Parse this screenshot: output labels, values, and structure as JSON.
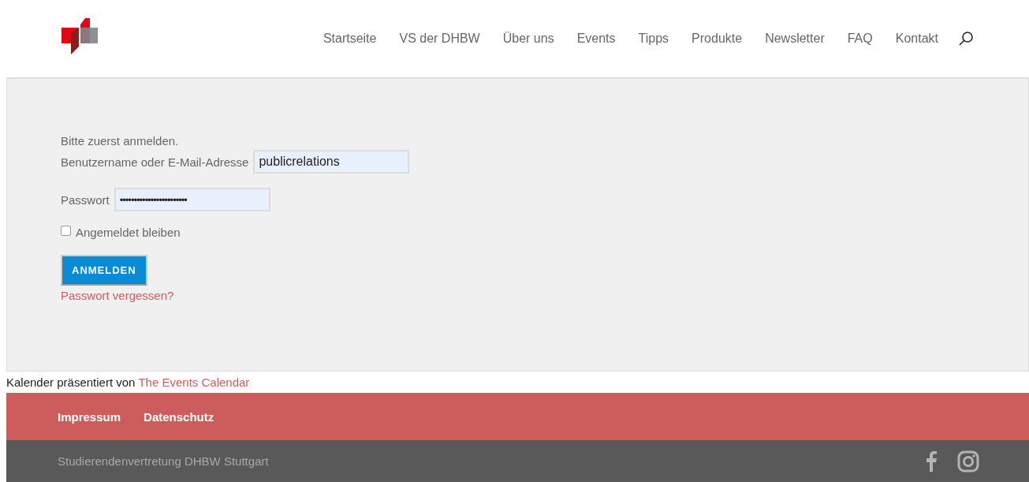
{
  "nav": {
    "items": [
      "Startseite",
      "VS der DHBW",
      "Über uns",
      "Events",
      "Tipps",
      "Produkte",
      "Newsletter",
      "FAQ",
      "Kontakt"
    ]
  },
  "login": {
    "notice": "Bitte zuerst anmelden.",
    "username": {
      "label": "Benutzername oder E-Mail-Adresse",
      "value": "publicrelations"
    },
    "password": {
      "label": "Passwort",
      "value": "••••••••••••••••••••••••"
    },
    "remember": {
      "label": "Angemeldet bleiben",
      "checked": false
    },
    "submit": "ANMELDEN",
    "forgot": "Passwort vergessen?"
  },
  "credit": {
    "text": "Kalender präsentiert von",
    "link": "The Events Calendar"
  },
  "footer": {
    "links": [
      "Impressum",
      "Datenschutz"
    ],
    "copyright": "Studierendenvertretung DHBW Stuttgart"
  }
}
